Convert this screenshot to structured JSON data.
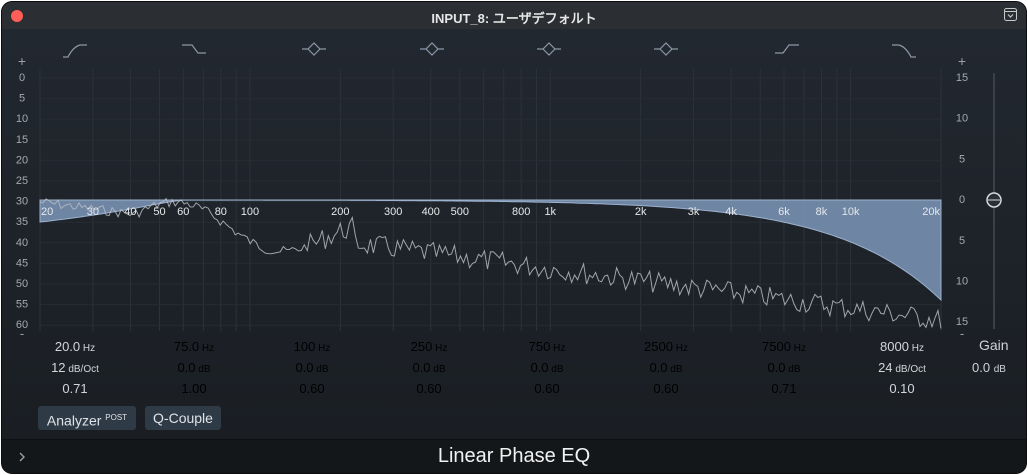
{
  "window": {
    "title": "INPUT_8: ユーザデフォルト"
  },
  "plugin": {
    "name": "Linear Phase EQ"
  },
  "colors": {
    "accent": "#7d97b9",
    "background": "#1c2126",
    "close": "#ff5f57"
  },
  "icons": {
    "close": "close-icon",
    "window_toggle": "view-toggle-icon",
    "expand": "chevron-right-icon"
  },
  "band_icons": [
    "high-pass-icon",
    "low-shelf-icon",
    "bell-icon",
    "bell-icon",
    "bell-icon",
    "bell-icon",
    "high-shelf-icon",
    "low-pass-icon"
  ],
  "left_axis": {
    "plus": "+",
    "minus": "-",
    "ticks": [
      "0",
      "5",
      "10",
      "15",
      "20",
      "25",
      "30",
      "35",
      "40",
      "45",
      "50",
      "55",
      "60"
    ]
  },
  "right_axis": {
    "plus": "+",
    "minus": "-",
    "ticks": [
      "15",
      "10",
      "5",
      "0",
      "5",
      "10",
      "15"
    ]
  },
  "freq_axis": [
    "20",
    "30",
    "40",
    "50",
    "60",
    "80",
    "100",
    "200",
    "300",
    "400",
    "500",
    "800",
    "1k",
    "2k",
    "3k",
    "4k",
    "6k",
    "8k",
    "10k",
    "20k"
  ],
  "bands": [
    {
      "freq": "20.0",
      "freq_unit": "Hz",
      "gain": "12",
      "gain_unit": "dB/Oct",
      "q": "0.71",
      "active": true
    },
    {
      "freq": "75.0",
      "freq_unit": "Hz",
      "gain": "0.0",
      "gain_unit": "dB",
      "q": "1.00",
      "active": false
    },
    {
      "freq": "100",
      "freq_unit": "Hz",
      "gain": "0.0",
      "gain_unit": "dB",
      "q": "0.60",
      "active": false
    },
    {
      "freq": "250",
      "freq_unit": "Hz",
      "gain": "0.0",
      "gain_unit": "dB",
      "q": "0.60",
      "active": false
    },
    {
      "freq": "750",
      "freq_unit": "Hz",
      "gain": "0.0",
      "gain_unit": "dB",
      "q": "0.60",
      "active": false
    },
    {
      "freq": "2500",
      "freq_unit": "Hz",
      "gain": "0.0",
      "gain_unit": "dB",
      "q": "0.60",
      "active": false
    },
    {
      "freq": "7500",
      "freq_unit": "Hz",
      "gain": "0.0",
      "gain_unit": "dB",
      "q": "0.71",
      "active": false
    },
    {
      "freq": "8000",
      "freq_unit": "Hz",
      "gain": "24",
      "gain_unit": "dB/Oct",
      "q": "0.10",
      "active": true
    }
  ],
  "buttons": {
    "analyzer": "Analyzer",
    "analyzer_sup": "POST",
    "qcouple": "Q-Couple"
  },
  "gain": {
    "label": "Gain",
    "value": "0.0",
    "unit": "dB",
    "db": 0
  }
}
